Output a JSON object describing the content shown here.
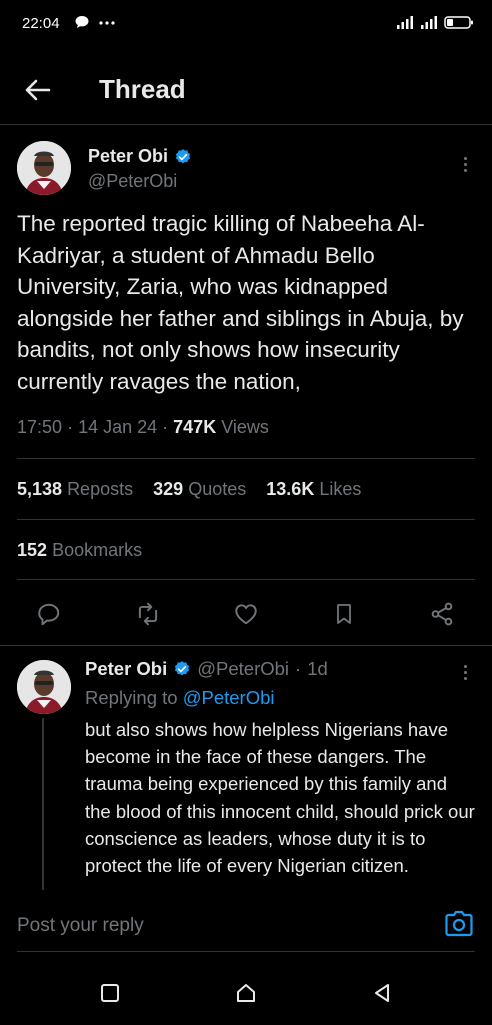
{
  "status_bar": {
    "time": "22:04"
  },
  "header": {
    "title": "Thread"
  },
  "main_tweet": {
    "author_name": "Peter Obi",
    "author_handle": "@PeterObi",
    "text": "The reported tragic killing of Nabeeha Al-Kadriyar, a student of Ahmadu Bello University, Zaria, who was kidnapped alongside her father and siblings in Abuja, by bandits, not only shows how insecurity currently ravages the nation,",
    "time": "17:50",
    "date": "14 Jan 24",
    "views_count": "747K",
    "views_label": "Views",
    "reposts_count": "5,138",
    "reposts_label": "Reposts",
    "quotes_count": "329",
    "quotes_label": "Quotes",
    "likes_count": "13.6K",
    "likes_label": "Likes",
    "bookmarks_count": "152",
    "bookmarks_label": "Bookmarks"
  },
  "reply_tweet": {
    "author_name": "Peter Obi",
    "author_handle": "@PeterObi",
    "age": "1d",
    "replying_to_label": "Replying to",
    "replying_to_handle": "@PeterObi",
    "text": "but also shows how helpless Nigerians have become in the face of these dangers. The trauma being experienced by this family and the blood of this innocent child, should prick our conscience as leaders, whose duty it is to protect the life of every Nigerian citizen."
  },
  "compose": {
    "placeholder": "Post your reply"
  },
  "colors": {
    "background": "#000000",
    "text_primary": "#e7e9ea",
    "text_secondary": "#71767b",
    "accent": "#1d9bf0",
    "divider": "#2f3336"
  },
  "icons": {
    "back": "arrow-left-icon",
    "verified": "verified-badge-icon",
    "more": "more-vertical-icon",
    "reply": "comment-icon",
    "repost": "repost-icon",
    "like": "heart-icon",
    "bookmark": "bookmark-icon",
    "share": "share-icon",
    "camera": "camera-icon",
    "nav_recent": "square-icon",
    "nav_home": "home-icon",
    "nav_back": "triangle-back-icon"
  }
}
